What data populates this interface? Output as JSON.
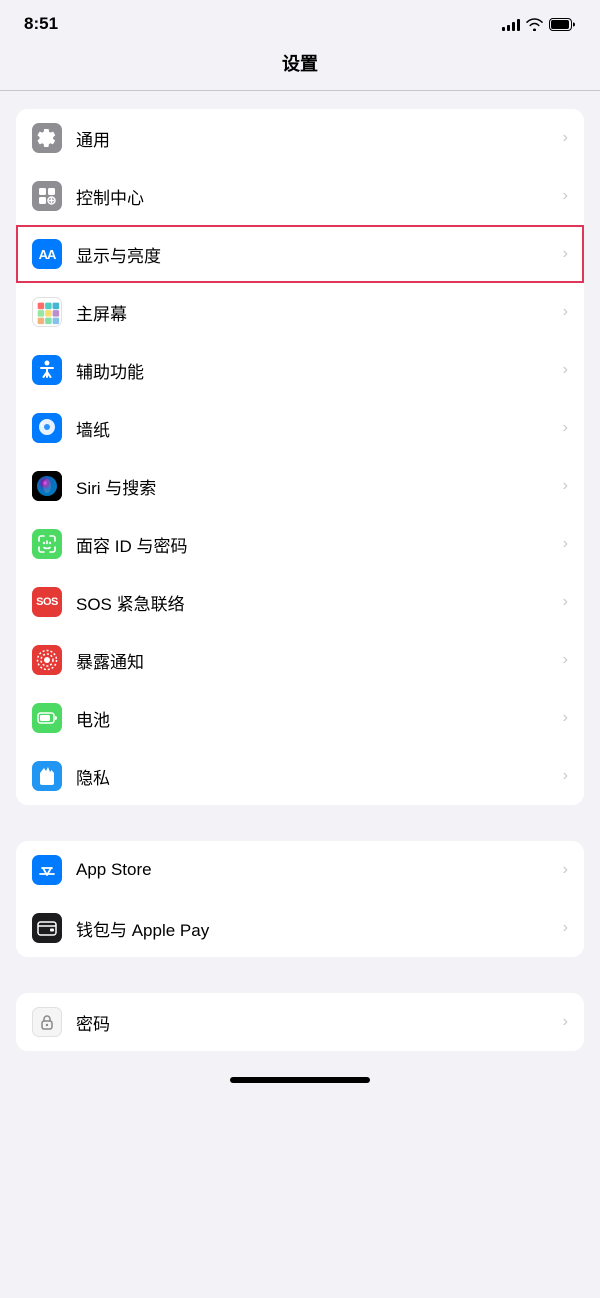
{
  "statusBar": {
    "time": "8:51"
  },
  "pageTitle": "设置",
  "groups": [
    {
      "id": "group1",
      "items": [
        {
          "id": "tongyong",
          "label": "通用",
          "iconClass": "icon-tongyong",
          "iconType": "gear",
          "highlighted": false
        },
        {
          "id": "kongzhi",
          "label": "控制中心",
          "iconClass": "icon-kongzhi",
          "iconType": "toggle",
          "highlighted": false
        },
        {
          "id": "xianshi",
          "label": "显示与亮度",
          "iconClass": "icon-xianshi",
          "iconType": "text-aa",
          "highlighted": true
        },
        {
          "id": "zhupingmu",
          "label": "主屏幕",
          "iconClass": "icon-zhupingmu",
          "iconType": "grid",
          "highlighted": false
        },
        {
          "id": "fuzhu",
          "label": "辅助功能",
          "iconClass": "icon-fuzhu",
          "iconType": "person-circle",
          "highlighted": false
        },
        {
          "id": "zhizhi",
          "label": "墙纸",
          "iconClass": "icon-zhizhi",
          "iconType": "flower",
          "highlighted": false
        },
        {
          "id": "siri",
          "label": "Siri 与搜索",
          "iconClass": "icon-siri",
          "iconType": "siri",
          "highlighted": false
        },
        {
          "id": "face",
          "label": "面容 ID 与密码",
          "iconClass": "icon-face",
          "iconType": "faceid",
          "highlighted": false
        },
        {
          "id": "sos",
          "label": "SOS 紧急联络",
          "iconClass": "icon-sos",
          "iconType": "sos-text",
          "highlighted": false
        },
        {
          "id": "baolu",
          "label": "暴露通知",
          "iconClass": "icon-baolu",
          "iconType": "exposure",
          "highlighted": false
        },
        {
          "id": "dianchi",
          "label": "电池",
          "iconClass": "icon-dianchi",
          "iconType": "battery",
          "highlighted": false
        },
        {
          "id": "yinsi",
          "label": "隐私",
          "iconClass": "icon-yinsi",
          "iconType": "hand",
          "highlighted": false
        }
      ]
    },
    {
      "id": "group2",
      "items": [
        {
          "id": "appstore",
          "label": "App Store",
          "iconClass": "icon-appstore",
          "iconType": "appstore",
          "highlighted": false
        },
        {
          "id": "wallet",
          "label": "钱包与 Apple Pay",
          "iconClass": "icon-wallet",
          "iconType": "wallet",
          "highlighted": false
        }
      ]
    },
    {
      "id": "group3",
      "items": [
        {
          "id": "mima",
          "label": "密码",
          "iconClass": "icon-mima",
          "iconType": "key",
          "highlighted": false
        }
      ]
    }
  ]
}
